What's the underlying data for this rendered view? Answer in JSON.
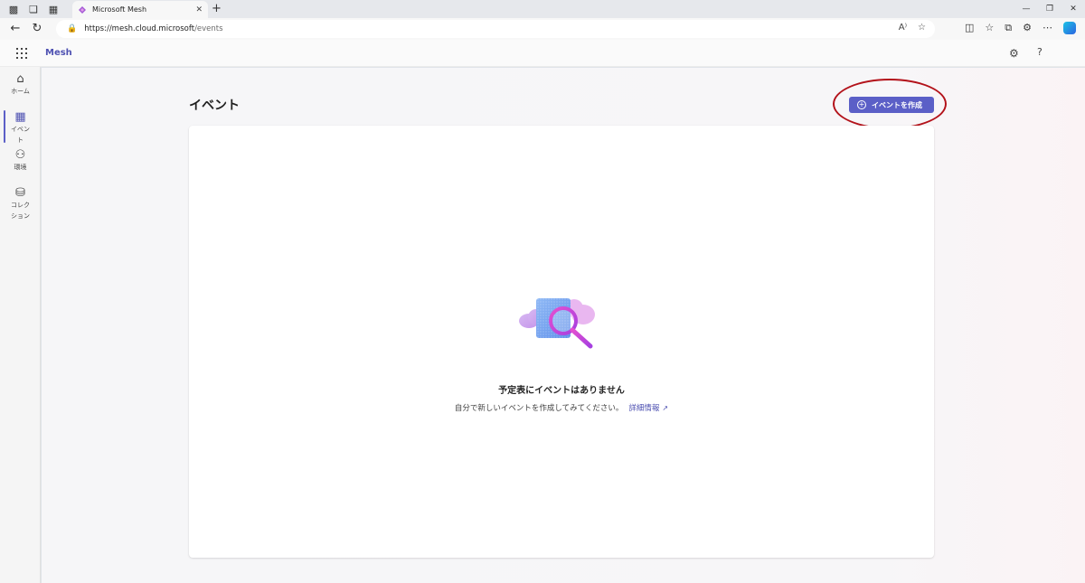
{
  "browser": {
    "tab_title": "Microsoft Mesh",
    "url_host": "https://mesh.cloud.microsoft",
    "url_path": "/events"
  },
  "app": {
    "name": "Mesh"
  },
  "rail": {
    "items": [
      {
        "label": "ホーム",
        "icon": "home-icon"
      },
      {
        "label": "イベント",
        "icon": "calendar-icon"
      },
      {
        "label": "環境",
        "icon": "environments-icon"
      },
      {
        "label": "コレクション",
        "icon": "collections-icon"
      }
    ]
  },
  "page": {
    "title": "イベント",
    "create_button": "イベントを作成"
  },
  "empty_state": {
    "title": "予定表にイベントはありません",
    "description": "自分で新しいイベントを作成してみてください。",
    "link": "詳細情報"
  },
  "colors": {
    "accent": "#5b5fc7",
    "brand_text": "#4f52b2",
    "annotation": "#b3121a"
  }
}
